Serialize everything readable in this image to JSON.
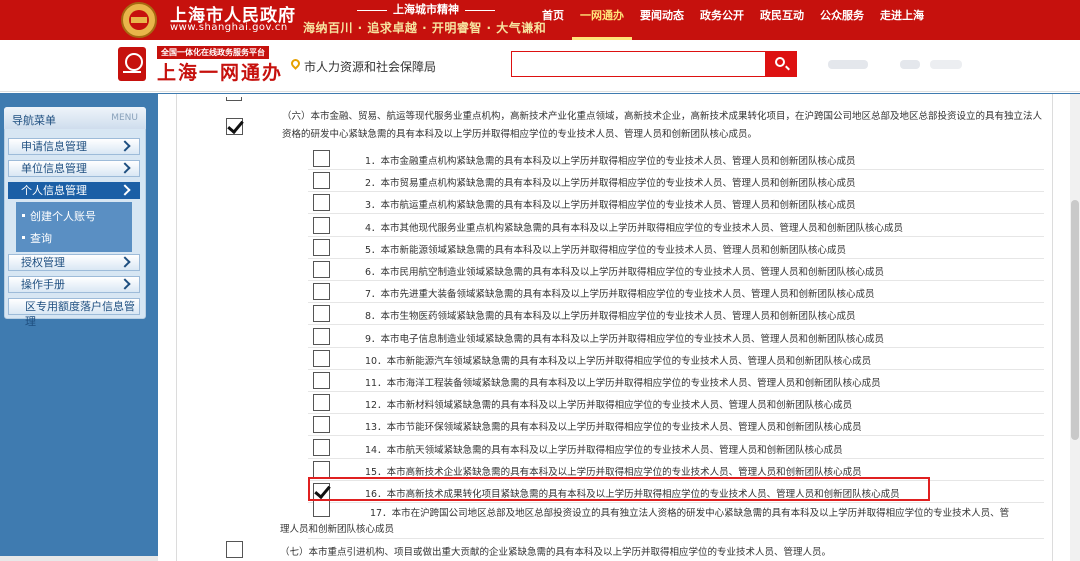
{
  "topbar": {
    "site_title": "上海市人民政府",
    "site_url": "www.shanghai.gov.cn",
    "spirit_title": "上海城市精神",
    "spirit_motto": "海纳百川 · 追求卓越 · 开明睿智 · 大气谦和",
    "nav": [
      "首页",
      "一网通办",
      "要闻动态",
      "政务公开",
      "政民互动",
      "公众服务",
      "走进上海"
    ],
    "active_nav": "一网通办"
  },
  "header2": {
    "badge": "全国一体化在线政务服务平台",
    "logo_name": "上海一网通办",
    "location": "市人力资源和社会保障局",
    "search_placeholder": ""
  },
  "sidebar": {
    "title": "导航菜单",
    "title_en": "MENU",
    "items": [
      "申请信息管理",
      "单位信息管理",
      "个人信息管理",
      "授权管理",
      "操作手册",
      "区专用额度落户信息管理"
    ],
    "active_item": "个人信息管理",
    "sub_items": [
      "创建个人账号",
      "查询"
    ]
  },
  "content": {
    "section6": "（六）本市金融、贸易、航运等现代服务业重点机构，高新技术产业化重点领域，高新技术企业，高新技术成果转化项目，在沪跨国公司地区总部及地区总部投资设立的具有独立法人资格的研发中心紧缺急需的具有本科及以上学历并取得相应学位的专业技术人员、管理人员和创新团队核心成员。",
    "section6_checked": true,
    "items": [
      {
        "text": "1．本市金融重点机构紧缺急需的具有本科及以上学历并取得相应学位的专业技术人员、管理人员和创新团队核心成员",
        "checked": false
      },
      {
        "text": "2．本市贸易重点机构紧缺急需的具有本科及以上学历并取得相应学位的专业技术人员、管理人员和创新团队核心成员",
        "checked": false
      },
      {
        "text": "3．本市航运重点机构紧缺急需的具有本科及以上学历并取得相应学位的专业技术人员、管理人员和创新团队核心成员",
        "checked": false
      },
      {
        "text": "4．本市其他现代服务业重点机构紧缺急需的具有本科及以上学历并取得相应学位的专业技术人员、管理人员和创新团队核心成员",
        "checked": false
      },
      {
        "text": "5．本市新能源领域紧缺急需的具有本科及以上学历并取得相应学位的专业技术人员、管理人员和创新团队核心成员",
        "checked": false
      },
      {
        "text": "6．本市民用航空制造业领域紧缺急需的具有本科及以上学历并取得相应学位的专业技术人员、管理人员和创新团队核心成员",
        "checked": false
      },
      {
        "text": "7．本市先进重大装备领域紧缺急需的具有本科及以上学历并取得相应学位的专业技术人员、管理人员和创新团队核心成员",
        "checked": false
      },
      {
        "text": "8．本市生物医药领域紧缺急需的具有本科及以上学历并取得相应学位的专业技术人员、管理人员和创新团队核心成员",
        "checked": false
      },
      {
        "text": "9．本市电子信息制造业领域紧缺急需的具有本科及以上学历并取得相应学位的专业技术人员、管理人员和创新团队核心成员",
        "checked": false
      },
      {
        "text": "10．本市新能源汽车领域紧缺急需的具有本科及以上学历并取得相应学位的专业技术人员、管理人员和创新团队核心成员",
        "checked": false
      },
      {
        "text": "11．本市海洋工程装备领域紧缺急需的具有本科及以上学历并取得相应学位的专业技术人员、管理人员和创新团队核心成员",
        "checked": false
      },
      {
        "text": "12．本市新材料领域紧缺急需的具有本科及以上学历并取得相应学位的专业技术人员、管理人员和创新团队核心成员",
        "checked": false
      },
      {
        "text": "13．本市节能环保领域紧缺急需的具有本科及以上学历并取得相应学位的专业技术人员、管理人员和创新团队核心成员",
        "checked": false
      },
      {
        "text": "14．本市航天领域紧缺急需的具有本科及以上学历并取得相应学位的专业技术人员、管理人员和创新团队核心成员",
        "checked": false
      },
      {
        "text": "15．本市高新技术企业紧缺急需的具有本科及以上学历并取得相应学位的专业技术人员、管理人员和创新团队核心成员",
        "checked": false
      },
      {
        "text": "16．本市高新技术成果转化项目紧缺急需的具有本科及以上学历并取得相应学位的专业技术人员、管理人员和创新团队核心成员",
        "checked": true
      }
    ],
    "item17_a": "17．本市在沪跨国公司地区总部及地区总部投资设立的具有独立法人资格的研发中心紧缺急需的具有本科及以上学历并取得相应学位的专业技术人员、管",
    "item17_b": "理人员和创新团队核心成员",
    "section7": "（七）本市重点引进机构、项目或做出重大贡献的企业紧缺急需的具有本科及以上学历并取得相应学位的专业技术人员、管理人员。"
  }
}
